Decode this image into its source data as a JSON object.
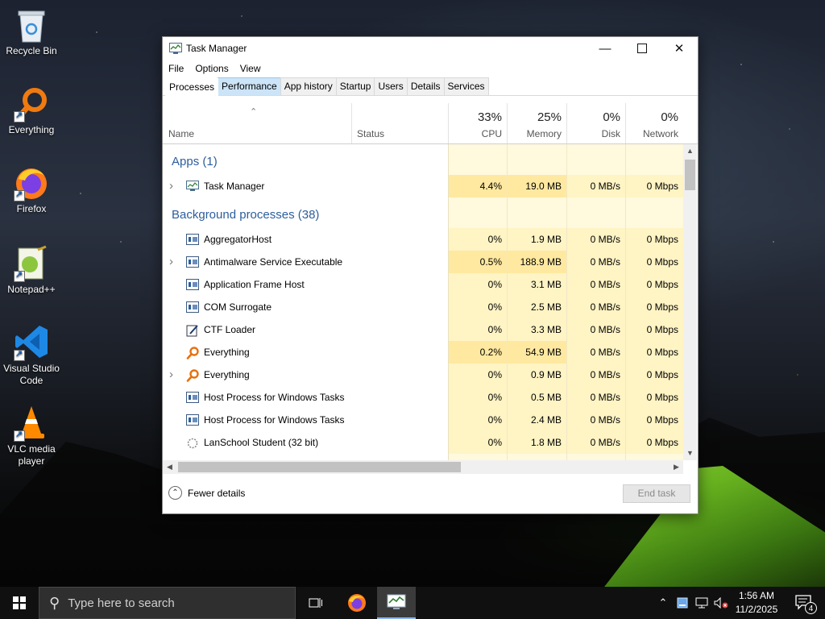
{
  "desktop": {
    "icons": [
      {
        "label": "Recycle Bin"
      },
      {
        "label": "Everything"
      },
      {
        "label": "Firefox"
      },
      {
        "label": "Notepad++"
      },
      {
        "label": "Visual Studio Code"
      },
      {
        "label": "VLC media player"
      }
    ]
  },
  "window": {
    "title": "Task Manager",
    "menu": [
      "File",
      "Options",
      "View"
    ],
    "tabs": [
      "Processes",
      "Performance",
      "App history",
      "Startup",
      "Users",
      "Details",
      "Services"
    ],
    "active_tab": "Processes",
    "columns": {
      "name": "Name",
      "status": "Status",
      "cpu": {
        "pct": "33%",
        "label": "CPU"
      },
      "memory": {
        "pct": "25%",
        "label": "Memory"
      },
      "disk": {
        "pct": "0%",
        "label": "Disk"
      },
      "network": {
        "pct": "0%",
        "label": "Network"
      }
    },
    "apps_group": "Apps (1)",
    "apps": [
      {
        "name": "Task Manager",
        "cpu": "4.4%",
        "memory": "19.0 MB",
        "disk": "0 MB/s",
        "network": "0 Mbps",
        "expandable": true,
        "icon": "task-manager-icon"
      }
    ],
    "background_group": "Background processes (38)",
    "background": [
      {
        "name": "AggregatorHost",
        "cpu": "0%",
        "memory": "1.9 MB",
        "disk": "0 MB/s",
        "network": "0 Mbps",
        "expandable": false,
        "icon": "process-icon"
      },
      {
        "name": "Antimalware Service Executable",
        "cpu": "0.5%",
        "memory": "188.9 MB",
        "disk": "0 MB/s",
        "network": "0 Mbps",
        "expandable": true,
        "icon": "process-icon"
      },
      {
        "name": "Application Frame Host",
        "cpu": "0%",
        "memory": "3.1 MB",
        "disk": "0 MB/s",
        "network": "0 Mbps",
        "expandable": false,
        "icon": "process-icon"
      },
      {
        "name": "COM Surrogate",
        "cpu": "0%",
        "memory": "2.5 MB",
        "disk": "0 MB/s",
        "network": "0 Mbps",
        "expandable": false,
        "icon": "process-icon"
      },
      {
        "name": "CTF Loader",
        "cpu": "0%",
        "memory": "3.3 MB",
        "disk": "0 MB/s",
        "network": "0 Mbps",
        "expandable": false,
        "icon": "ctf-loader-icon"
      },
      {
        "name": "Everything",
        "cpu": "0.2%",
        "memory": "54.9 MB",
        "disk": "0 MB/s",
        "network": "0 Mbps",
        "expandable": false,
        "icon": "everything-icon"
      },
      {
        "name": "Everything",
        "cpu": "0%",
        "memory": "0.9 MB",
        "disk": "0 MB/s",
        "network": "0 Mbps",
        "expandable": true,
        "icon": "everything-icon"
      },
      {
        "name": "Host Process for Windows Tasks",
        "cpu": "0%",
        "memory": "0.5 MB",
        "disk": "0 MB/s",
        "network": "0 Mbps",
        "expandable": false,
        "icon": "process-icon"
      },
      {
        "name": "Host Process for Windows Tasks",
        "cpu": "0%",
        "memory": "2.4 MB",
        "disk": "0 MB/s",
        "network": "0 Mbps",
        "expandable": false,
        "icon": "process-icon"
      },
      {
        "name": "LanSchool Student (32 bit)",
        "cpu": "0%",
        "memory": "1.8 MB",
        "disk": "0 MB/s",
        "network": "0 Mbps",
        "expandable": false,
        "icon": "lanschool-icon"
      }
    ],
    "footer": {
      "fewer_details": "Fewer details",
      "end_task": "End task"
    }
  },
  "taskbar": {
    "search_placeholder": "Type here to search",
    "time": "1:56 AM",
    "date": "11/2/2025",
    "notification_count": "4"
  },
  "colors": {
    "group_text": "#2c5e9e",
    "heat_low": "#fff4c4",
    "heat_mid": "#ffe9a0",
    "tab_highlight": "#cce4f7",
    "taskbar": "#101010"
  }
}
